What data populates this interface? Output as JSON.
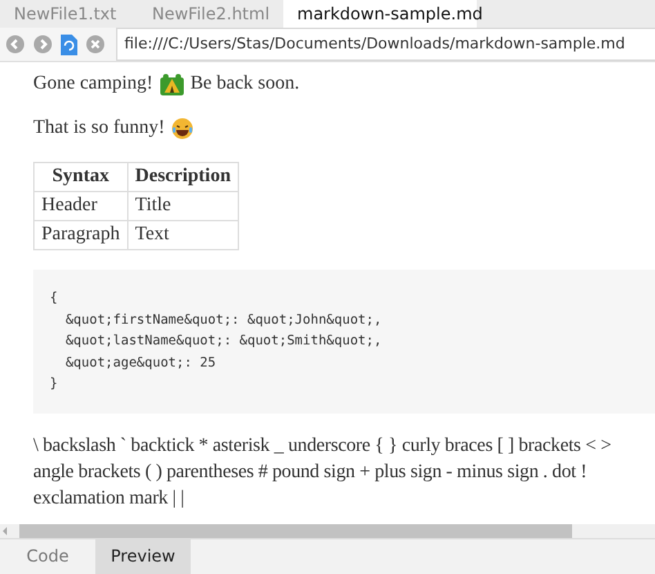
{
  "file_tabs": [
    {
      "label": "NewFile1.txt",
      "selected": false
    },
    {
      "label": "NewFile2.html",
      "selected": false
    },
    {
      "label": "markdown-sample.md",
      "selected": true
    }
  ],
  "address": {
    "value": "file:///C:/Users/Stas/Documents/Downloads/markdown-sample.md"
  },
  "content": {
    "emoji_lines": [
      {
        "text_before": "Gone camping!",
        "text_after": "Be back soon."
      },
      {
        "text_before": "That is so funny!"
      }
    ],
    "table": {
      "columns": [
        "Syntax",
        "Description"
      ],
      "rows": [
        [
          "Header",
          "Title"
        ],
        [
          "Paragraph",
          "Text"
        ]
      ]
    },
    "code_block": [
      "{",
      "  &quot;firstName&quot;: &quot;John&quot;,",
      "  &quot;lastName&quot;: &quot;Smith&quot;,",
      "  &quot;age&quot;: 25",
      "}"
    ],
    "escapes_paragraph": "\\ backslash ` backtick * asterisk _ underscore { } curly braces [ ] brackets < > angle brackets ( ) parentheses # pound sign + plus sign - minus sign . dot ! exclamation mark | |"
  },
  "view_tabs": [
    {
      "label": "Code",
      "selected": false
    },
    {
      "label": "Preview",
      "selected": true
    }
  ]
}
